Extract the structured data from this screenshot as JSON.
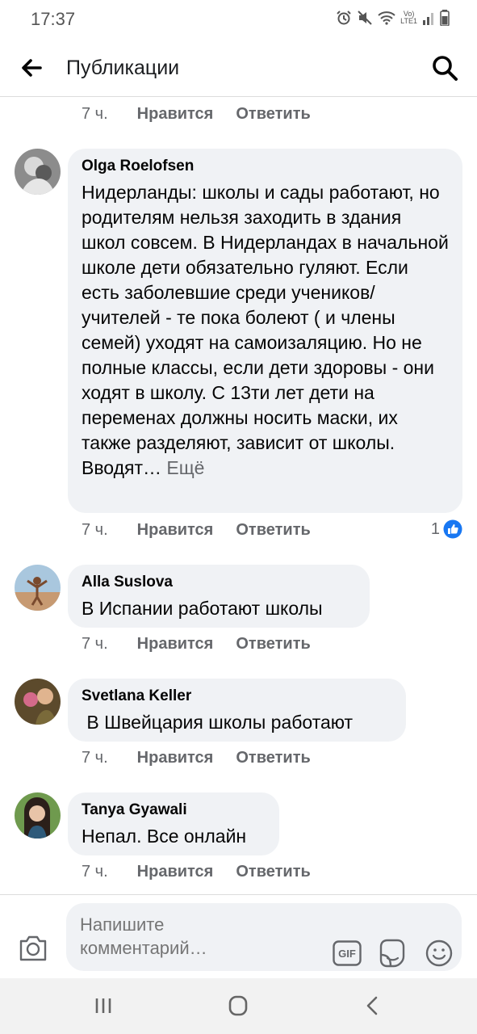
{
  "status_bar": {
    "time": "17:37",
    "network_label": "LTE1",
    "icons": [
      "alarm-icon",
      "mute-icon",
      "wifi-icon",
      "volte-icon",
      "signal-icon",
      "battery-icon"
    ]
  },
  "header": {
    "title": "Публикации",
    "back_icon": "arrow-left-icon",
    "search_icon": "search-icon"
  },
  "top_actions": {
    "time": "7 ч.",
    "like": "Нравится",
    "reply": "Ответить"
  },
  "comments": [
    {
      "author": "Olga Roelofsen",
      "text": "Нидерланды: школы и сады работают, но родителям нельзя заходить в здания школ совсем. В Нидерландах в начальной школе дети обязательно гуляют. Если есть заболевшие среди учеников/учителей - те пока болеют ( и члены семей) уходят на самоизаляцию. Но не полные классы, если дети здоровы - они ходят в школу. С 13ти лет дети на переменах должны носить маски, их также разделяют, зависит от школы. Вводят…",
      "more_label": "Ещё",
      "time": "7 ч.",
      "like": "Нравится",
      "reply": "Ответить",
      "reaction_count": "1",
      "reaction_icon": "like-reaction-icon"
    },
    {
      "author": "Alla Suslova",
      "text": "В Испании работают школы",
      "time": "7 ч.",
      "like": "Нравится",
      "reply": "Ответить"
    },
    {
      "author": "Svetlana Keller",
      "text": " В Швейцария школы работают",
      "time": "7 ч.",
      "like": "Нравится",
      "reply": "Ответить"
    },
    {
      "author": "Tanya Gyawali",
      "text": "Непал. Все онлайн",
      "time": "7 ч.",
      "like": "Нравится",
      "reply": "Ответить"
    }
  ],
  "composer": {
    "placeholder": "Напишите комментарий…",
    "gif_label": "GIF",
    "icons": [
      "camera-icon",
      "gif-icon",
      "sticker-icon",
      "emoji-icon"
    ]
  },
  "nav_bar": {
    "icons": [
      "recent-apps-icon",
      "home-icon",
      "back-icon"
    ]
  },
  "colors": {
    "facebook_blue": "#1877f2",
    "bubble": "#f0f2f5",
    "secondary_text": "#65676b"
  }
}
